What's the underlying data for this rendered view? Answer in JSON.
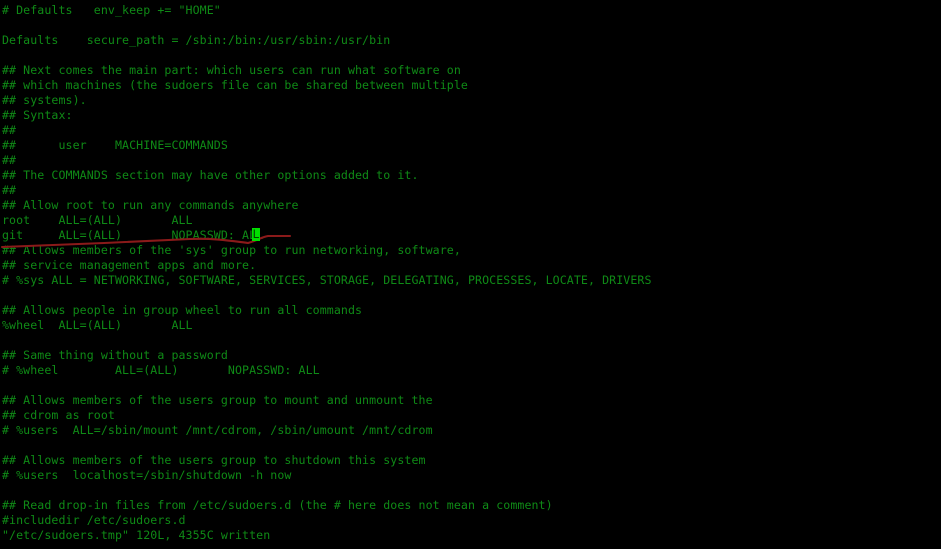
{
  "terminal": {
    "background_color": "#000000",
    "text_color": "#0f8a16",
    "cursor_color": "#00e000",
    "annotation_color": "#8b1a1a",
    "editor": "visudo",
    "file": "/etc/sudoers.tmp"
  },
  "cursor": {
    "character": "L",
    "line_number": 16,
    "column": 35
  },
  "lines": [
    "# Defaults   env_keep += \"HOME\"",
    "",
    "Defaults    secure_path = /sbin:/bin:/usr/sbin:/usr/bin",
    "",
    "## Next comes the main part: which users can run what software on",
    "## which machines (the sudoers file can be shared between multiple",
    "## systems).",
    "## Syntax:",
    "##",
    "##      user    MACHINE=COMMANDS",
    "##",
    "## The COMMANDS section may have other options added to it.",
    "##",
    "## Allow root to run any commands anywhere",
    "root    ALL=(ALL)       ALL",
    "git     ALL=(ALL)       NOPASSWD: ALL",
    "## Allows members of the 'sys' group to run networking, software,",
    "## service management apps and more.",
    "# %sys ALL = NETWORKING, SOFTWARE, SERVICES, STORAGE, DELEGATING, PROCESSES, LOCATE, DRIVERS",
    "",
    "## Allows people in group wheel to run all commands",
    "%wheel  ALL=(ALL)       ALL",
    "",
    "## Same thing without a password",
    "# %wheel        ALL=(ALL)       NOPASSWD: ALL",
    "",
    "## Allows members of the users group to mount and unmount the",
    "## cdrom as root",
    "# %users  ALL=/sbin/mount /mnt/cdrom, /sbin/umount /mnt/cdrom",
    "",
    "## Allows members of the users group to shutdown this system",
    "# %users  localhost=/sbin/shutdown -h now",
    "",
    "## Read drop-in files from /etc/sudoers.d (the # here does not mean a comment)",
    "#includedir /etc/sudoers.d"
  ],
  "status_line": "\"/etc/sudoers.tmp\" 120L, 4355C written"
}
